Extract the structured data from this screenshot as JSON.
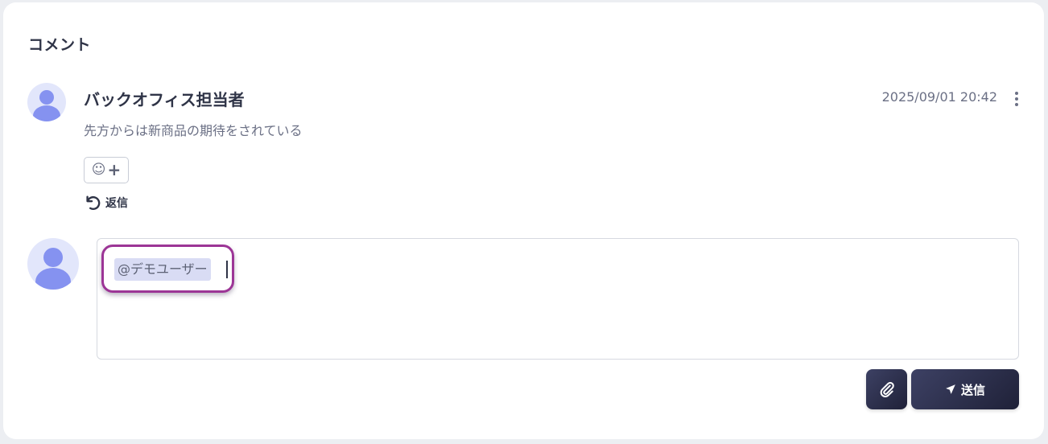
{
  "section": {
    "title": "コメント"
  },
  "comment": {
    "author": "バックオフィス担当者",
    "timestamp": "2025/09/01 20:42",
    "body": "先方からは新商品の期待をされている",
    "reply_label": "返信"
  },
  "composer": {
    "mention": "@デモユーザー"
  },
  "actions": {
    "send_label": "送信"
  },
  "icons": {
    "more": "more-vertical-icon",
    "reaction": "emoji-add-icon",
    "reply": "reply-icon",
    "attach": "paperclip-icon",
    "send": "paper-plane-icon"
  },
  "colors": {
    "avatar_bg": "#e2e6fb",
    "avatar_fg": "#8592f0",
    "mention_bg": "#d9dcf4",
    "highlight_outline": "#9c3596",
    "button_dark": "#2a2d48"
  }
}
